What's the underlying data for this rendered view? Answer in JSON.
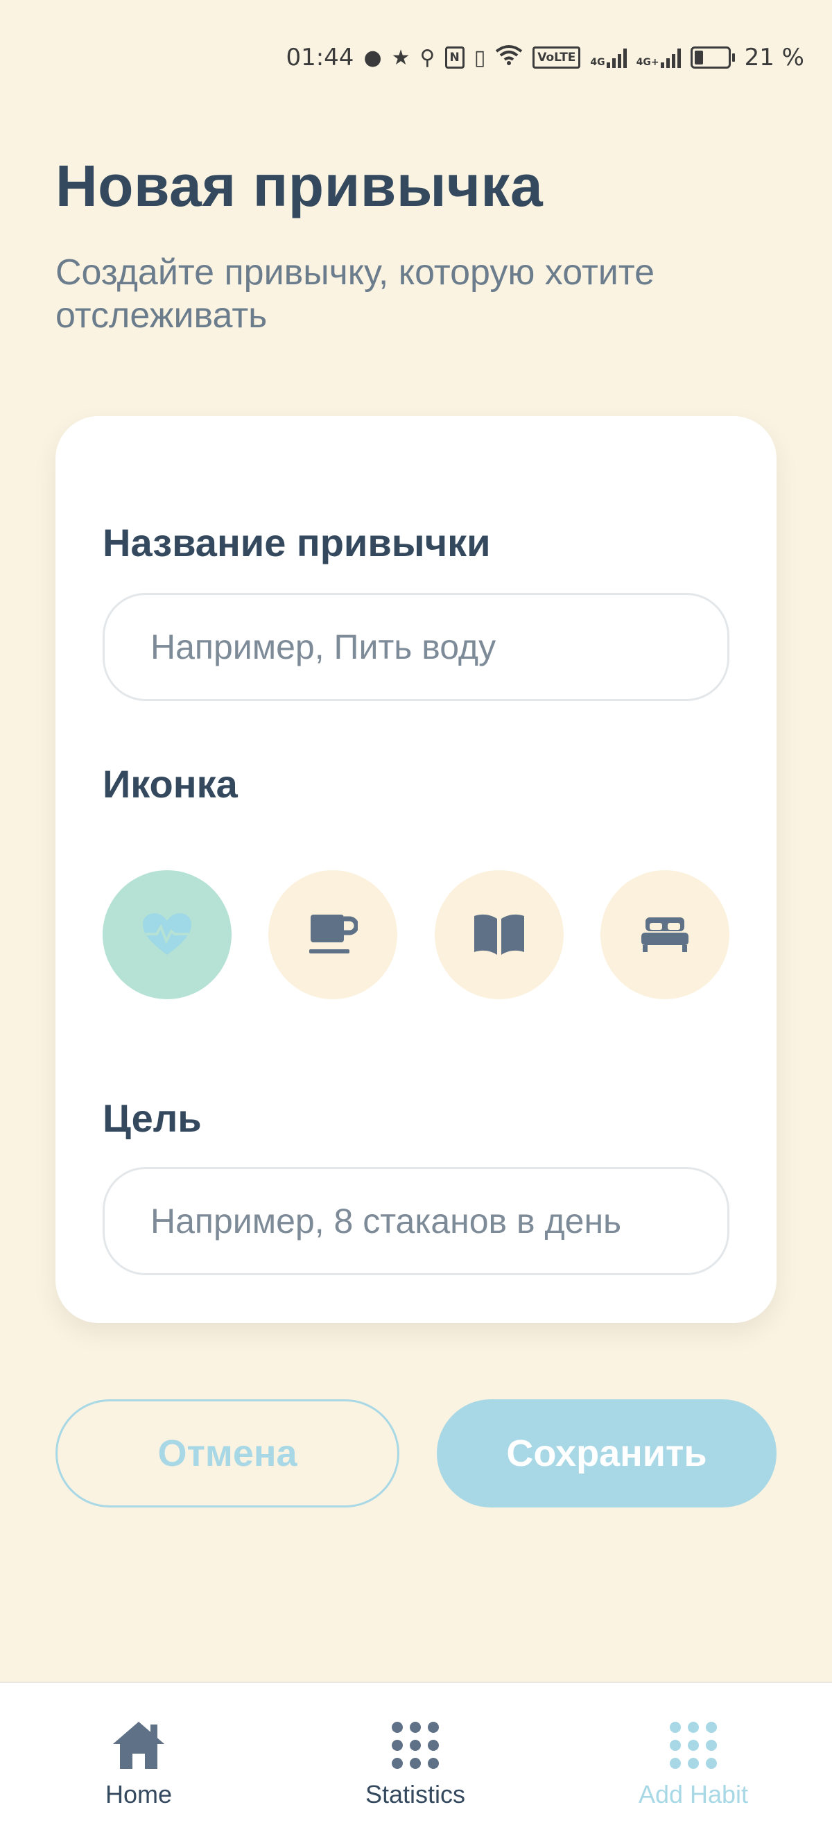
{
  "status_bar": {
    "time": "01:44",
    "battery_percent": "21 %",
    "network_label": "VoLTE",
    "network_gen_1": "4G",
    "network_gen_2": "4G+"
  },
  "header": {
    "title": "Новая привычка",
    "subtitle": "Создайте привычку, которую хотите отслеживать"
  },
  "form": {
    "name_label": "Название привычки",
    "name_placeholder": "Например, Пить воду",
    "name_value": "",
    "icon_label": "Иконка",
    "icons": [
      {
        "name": "heart-pulse-icon",
        "selected": true
      },
      {
        "name": "cup-icon",
        "selected": false
      },
      {
        "name": "book-icon",
        "selected": false
      },
      {
        "name": "bed-icon",
        "selected": false
      }
    ],
    "goal_label": "Цель",
    "goal_placeholder": "Например, 8 стаканов в день",
    "goal_value": ""
  },
  "actions": {
    "cancel_label": "Отмена",
    "save_label": "Сохранить"
  },
  "nav": {
    "items": [
      {
        "label": "Home",
        "icon": "home-icon",
        "active": false
      },
      {
        "label": "Statistics",
        "icon": "grid-icon",
        "active": false
      },
      {
        "label": "Add Habit",
        "icon": "grid-icon",
        "active": true
      }
    ]
  },
  "colors": {
    "background": "#faf3e1",
    "card": "#ffffff",
    "text_primary": "#34495e",
    "text_secondary": "#6b7c8c",
    "accent": "#a8d8e6",
    "selected_icon_bg": "#b5e2d4",
    "icon_bg": "#fbf1dc"
  }
}
